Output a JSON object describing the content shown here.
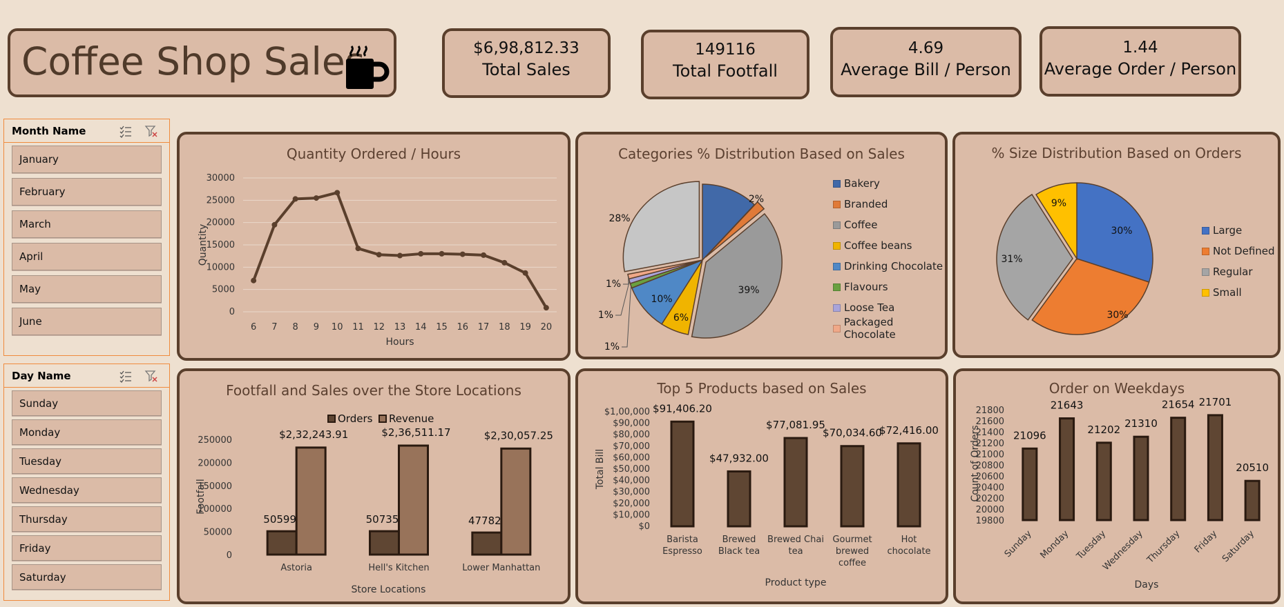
{
  "title": "Coffee Shop Sales",
  "kpis": [
    {
      "value": "$6,98,812.33",
      "label": "Total Sales"
    },
    {
      "value": "149116",
      "label": "Total Footfall"
    },
    {
      "value": "4.69",
      "label": "Average Bill / Person"
    },
    {
      "value": "1.44",
      "label": "Average Order / Person"
    }
  ],
  "slicers": {
    "month": {
      "title": "Month Name",
      "items": [
        "January",
        "February",
        "March",
        "April",
        "May",
        "June"
      ]
    },
    "day": {
      "title": "Day Name",
      "items": [
        "Sunday",
        "Monday",
        "Tuesday",
        "Wednesday",
        "Thursday",
        "Friday",
        "Saturday"
      ]
    }
  },
  "colors": {
    "background": "#eee0d0",
    "panel": "#dbbba7",
    "border": "#5a3f2c",
    "dark_brown": "#5f4633",
    "light_brown": "#98735a",
    "line": "#5a3f2c"
  },
  "chart_data": [
    {
      "id": "qty-hours",
      "type": "line",
      "title": "Quantity Ordered / Hours",
      "xlabel": "Hours",
      "ylabel": "Quantity",
      "x": [
        6,
        7,
        8,
        9,
        10,
        11,
        12,
        13,
        14,
        15,
        16,
        17,
        18,
        19,
        20
      ],
      "values": [
        7000,
        19500,
        25300,
        25500,
        26700,
        14200,
        12800,
        12600,
        13000,
        13000,
        12900,
        12700,
        11000,
        8700,
        900
      ],
      "ylim": [
        0,
        30000
      ],
      "yticks": [
        0,
        5000,
        10000,
        15000,
        20000,
        25000,
        30000
      ],
      "grid": true
    },
    {
      "id": "category-pie",
      "type": "pie",
      "title": "Categories % Distribution Based on Sales",
      "categories": [
        "Bakery",
        "Branded",
        "Coffee",
        "Coffee beans",
        "Drinking Chocolate",
        "Flavours",
        "Loose Tea",
        "Packaged Chocolate"
      ],
      "values": [
        12,
        2,
        39,
        6,
        10,
        1,
        1,
        1
      ],
      "labels": [
        "12%",
        "2%",
        "39%",
        "6%",
        "10%",
        "1%",
        "1%",
        "1%"
      ],
      "colors": [
        "#4169a8",
        "#e07a38",
        "#9a9a9a",
        "#f0b400",
        "#4f88c6",
        "#6aa040",
        "#a9a4da",
        "#f0a888"
      ],
      "extra_slice": {
        "label": "28%",
        "value": 28,
        "color": "#c6c6c6"
      },
      "legend": "right"
    },
    {
      "id": "size-pie",
      "type": "pie",
      "title": "% Size Distribution Based on Orders",
      "categories": [
        "Large",
        "Not Defined",
        "Regular",
        "Small"
      ],
      "values": [
        30,
        30,
        31,
        9
      ],
      "labels": [
        "30%",
        "30%",
        "31%",
        "9%"
      ],
      "colors": [
        "#4472c4",
        "#ed7d31",
        "#a5a5a5",
        "#ffc000"
      ],
      "legend": "right"
    },
    {
      "id": "store-footfall",
      "type": "bar",
      "title": "Footfall and Sales over the Store Locations",
      "xlabel": "Store Locations",
      "ylabel": "Footfall",
      "categories": [
        "Astoria",
        "Hell's Kitchen",
        "Lower Manhattan"
      ],
      "series": [
        {
          "name": "Orders",
          "values": [
            50599,
            50735,
            47782
          ],
          "labels": [
            "50599",
            "50735",
            "47782"
          ]
        },
        {
          "name": "Revenue",
          "values": [
            232243.91,
            236511.17,
            230057.25
          ],
          "labels": [
            "$2,32,243.91",
            "$2,36,511.17",
            "$2,30,057.25"
          ]
        }
      ],
      "ylim": [
        0,
        250000
      ],
      "yticks": [
        0,
        50000,
        100000,
        150000,
        200000,
        250000
      ],
      "legend": "top"
    },
    {
      "id": "top-products",
      "type": "bar",
      "title": "Top 5 Products based on Sales",
      "xlabel": "Product type",
      "ylabel": "Total Bill",
      "categories": [
        [
          "Barista",
          "Espresso"
        ],
        [
          "Brewed",
          "Black tea"
        ],
        [
          "Brewed Chai",
          "tea"
        ],
        [
          "Gourmet",
          "brewed",
          "coffee"
        ],
        [
          "Hot",
          "chocolate"
        ]
      ],
      "values": [
        91406.2,
        47932.0,
        77081.95,
        70034.6,
        72416.0
      ],
      "labels": [
        "$91,406.20",
        "$47,932.00",
        "$77,081.95",
        "$70,034.60",
        "$72,416.00"
      ],
      "ylim": [
        0,
        100000
      ],
      "yticks": [
        "$0",
        "$10,000",
        "$20,000",
        "$30,000",
        "$40,000",
        "$50,000",
        "$60,000",
        "$70,000",
        "$80,000",
        "$90,000",
        "$1,00,000"
      ]
    },
    {
      "id": "weekday-orders",
      "type": "bar",
      "title": "Order on Weekdays",
      "xlabel": "Days",
      "ylabel": "Count of Orders",
      "categories": [
        "Sunday",
        "Monday",
        "Tuesday",
        "Wednesday",
        "Thursday",
        "Friday",
        "Saturday"
      ],
      "values": [
        21096,
        21643,
        21202,
        21310,
        21654,
        21701,
        20510
      ],
      "labels": [
        "21096",
        "21643",
        "21202",
        "21310",
        "21654",
        "21701",
        "20510"
      ],
      "ylim": [
        19800,
        21800
      ],
      "yticks": [
        19800,
        20000,
        20200,
        20400,
        20600,
        20800,
        21000,
        21200,
        21400,
        21600,
        21800
      ]
    }
  ]
}
